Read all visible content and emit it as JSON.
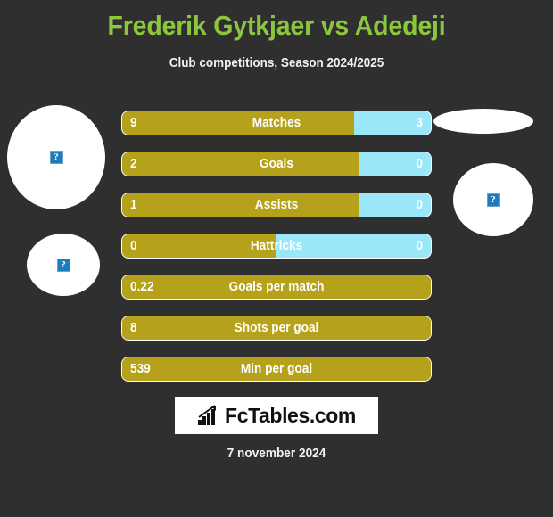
{
  "header": {
    "title": "Frederik Gytkjaer vs Adedeji",
    "subtitle": "Club competitions, Season 2024/2025",
    "title_color": "#8cc63f",
    "subtitle_color": "#f2f2f2"
  },
  "theme": {
    "background": "#2f2f2f",
    "home_bar_color": "#b5a21a",
    "away_bar_color": "#9be7fa",
    "bar_border": "#ffffff",
    "text_color": "#ffffff"
  },
  "placeholders": [
    {
      "name": "home-player-photo-top",
      "icon": "broken-image-icon",
      "glyph": "?"
    },
    {
      "name": "home-player-photo-bottom",
      "icon": "broken-image-icon",
      "glyph": "?"
    },
    {
      "name": "away-player-photo-top",
      "icon": "broken-image-icon",
      "glyph": ""
    },
    {
      "name": "away-player-photo-bottom",
      "icon": "broken-image-icon",
      "glyph": "?"
    }
  ],
  "stats": [
    {
      "label": "Matches",
      "home": "9",
      "away": "3",
      "home_pct": 75,
      "has_away": true
    },
    {
      "label": "Goals",
      "home": "2",
      "away": "0",
      "home_pct": 77,
      "has_away": true
    },
    {
      "label": "Assists",
      "home": "1",
      "away": "0",
      "home_pct": 77,
      "has_away": true
    },
    {
      "label": "Hattricks",
      "home": "0",
      "away": "0",
      "home_pct": 50,
      "has_away": true
    },
    {
      "label": "Goals per match",
      "home": "0.22",
      "away": "",
      "home_pct": 100,
      "has_away": false
    },
    {
      "label": "Shots per goal",
      "home": "8",
      "away": "",
      "home_pct": 100,
      "has_away": false
    },
    {
      "label": "Min per goal",
      "home": "539",
      "away": "",
      "home_pct": 100,
      "has_away": false
    }
  ],
  "logo": {
    "text": "FcTables.com",
    "icon": "bar-chart-icon"
  },
  "footer": {
    "date": "7 november 2024"
  }
}
